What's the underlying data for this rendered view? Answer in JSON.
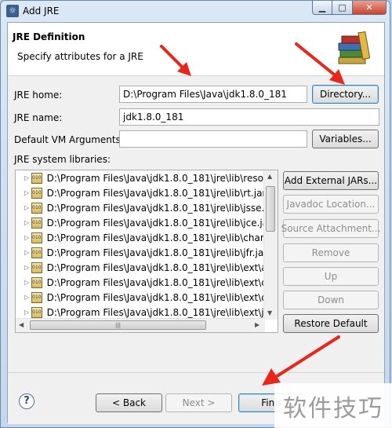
{
  "window": {
    "title": "Add JRE"
  },
  "header": {
    "title": "JRE Definition",
    "subtitle": "Specify attributes for a JRE"
  },
  "jre_home": {
    "label": "JRE home:",
    "value": "D:\\Program Files\\Java\\jdk1.8.0_181",
    "button": "Directory..."
  },
  "jre_name": {
    "label": "JRE name:",
    "value": "jdk1.8.0_181"
  },
  "vm_args": {
    "label": "Default VM Arguments:",
    "value": "",
    "button": "Variables..."
  },
  "libraries": {
    "label": "JRE system libraries:",
    "items": [
      "D:\\Program Files\\Java\\jdk1.8.0_181\\jre\\lib\\resourc",
      "D:\\Program Files\\Java\\jdk1.8.0_181\\jre\\lib\\rt.jar",
      "D:\\Program Files\\Java\\jdk1.8.0_181\\jre\\lib\\jsse.jar",
      "D:\\Program Files\\Java\\jdk1.8.0_181\\jre\\lib\\jce.jar",
      "D:\\Program Files\\Java\\jdk1.8.0_181\\jre\\lib\\charset",
      "D:\\Program Files\\Java\\jdk1.8.0_181\\jre\\lib\\jfr.jar",
      "D:\\Program Files\\Java\\jdk1.8.0_181\\jre\\lib\\ext\\acc",
      "D:\\Program Files\\Java\\jdk1.8.0_181\\jre\\lib\\ext\\cldr",
      "D:\\Program Files\\Java\\jdk1.8.0_181\\jre\\lib\\ext\\dns",
      "D:\\Program Files\\Java\\jdk1.8.0_181\\jre\\lib\\ext\\jacc"
    ],
    "icon_label": "010"
  },
  "side_buttons": {
    "add_external": "Add External JARs...",
    "javadoc": "Javadoc Location...",
    "source": "Source Attachment...",
    "remove": "Remove",
    "up": "Up",
    "down": "Down",
    "restore": "Restore Default"
  },
  "footer": {
    "back": "< Back",
    "next": "Next >",
    "finish": "Finis",
    "help": "?"
  },
  "watermark": "软件技巧",
  "colors": {
    "arrow": "#e8261b",
    "titlebar": "#c4d7ec",
    "close": "#c8442e"
  }
}
